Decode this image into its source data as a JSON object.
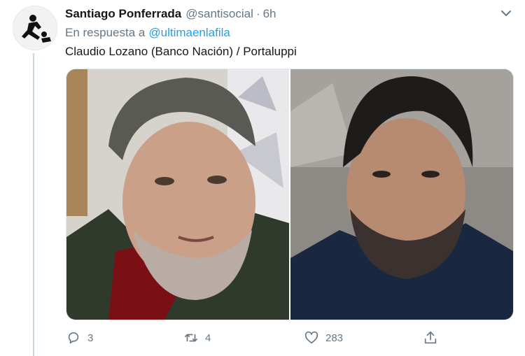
{
  "tweet": {
    "author_name": "Santiago Ponferrada",
    "author_handle": "@santisocial",
    "separator": "·",
    "time": "6h",
    "reply_prefix": "En respuesta a",
    "reply_mention": "@ultimaenlafila",
    "text": "Claudio Lozano (Banco Nación) / Portaluppi",
    "media": [
      {
        "subject": "photo-left"
      },
      {
        "subject": "photo-right"
      }
    ]
  },
  "actions": {
    "reply_count": "3",
    "retweet_count": "4",
    "like_count": "283",
    "share_count": ""
  },
  "icons": {
    "reply": "reply-icon",
    "retweet": "retweet-icon",
    "like": "heart-icon",
    "share": "share-icon",
    "menu": "chevron-down-icon"
  },
  "colors": {
    "link": "#1da1f2",
    "muted": "#657786",
    "text": "#14171a"
  }
}
